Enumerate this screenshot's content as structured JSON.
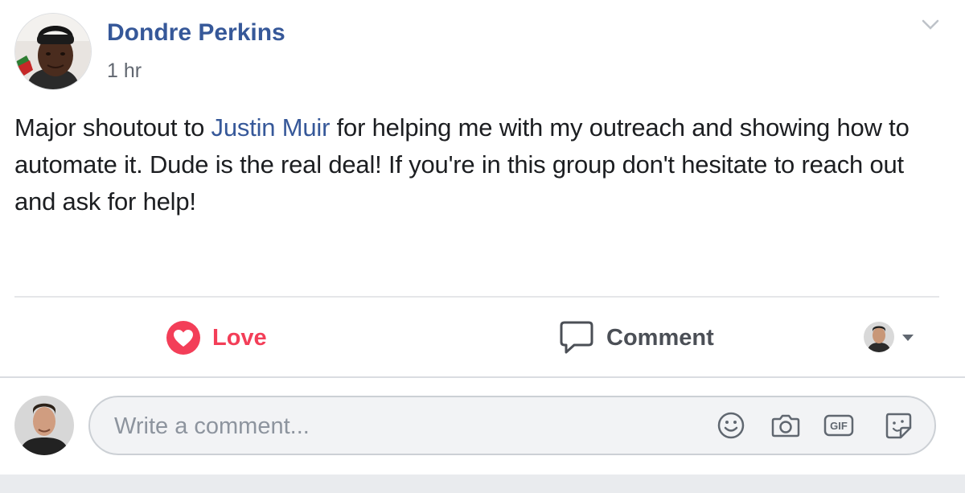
{
  "post": {
    "author": "Dondre Perkins",
    "timestamp": "1 hr",
    "text_before": "Major shoutout to ",
    "mention": "Justin Muir",
    "text_after": " for helping me with my outreach and showing how to automate it. Dude is the real deal! If you're in this group don't hesitate to reach out and ask for help!"
  },
  "actions": {
    "love_label": "Love",
    "comment_label": "Comment"
  },
  "composer": {
    "placeholder": "Write a comment..."
  },
  "icons": {
    "options": "chevron-down-icon",
    "love": "heart-icon",
    "comment": "speech-bubble-icon",
    "emoji": "smiley-icon",
    "camera": "camera-icon",
    "gif": "gif-icon",
    "sticker": "sticker-icon",
    "dropdown": "caret-down-icon"
  },
  "colors": {
    "link": "#365899",
    "love": "#f33e58",
    "text": "#1c1e21",
    "muted": "#616770"
  }
}
